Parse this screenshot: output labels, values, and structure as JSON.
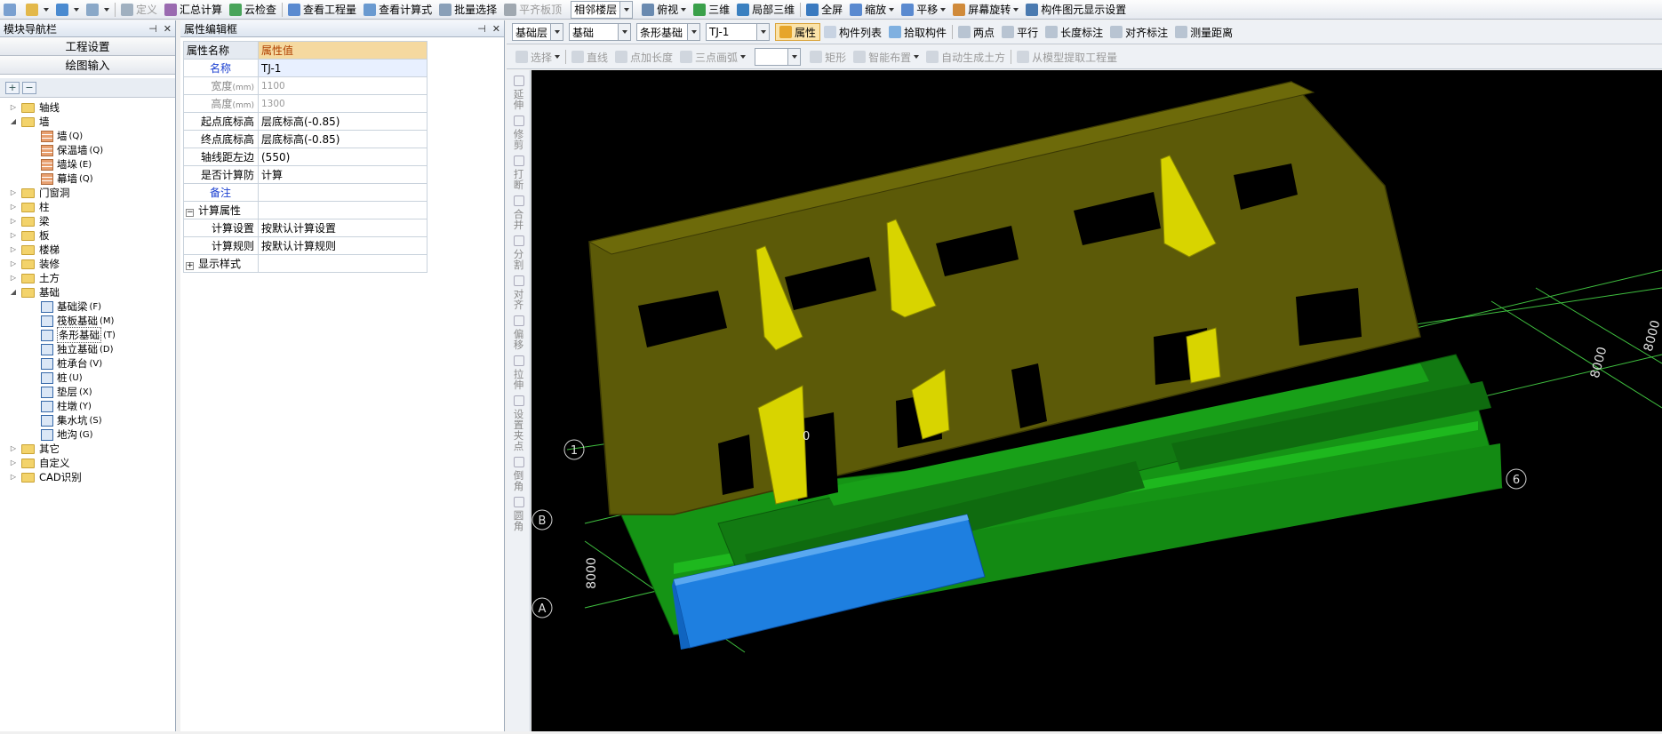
{
  "main_toolbar": [
    {
      "label": "",
      "icon": "new-file-icon"
    },
    {
      "label": "",
      "icon": "open-folder-icon"
    },
    {
      "label": "",
      "icon": "undo-icon"
    },
    {
      "label": "",
      "icon": "redo-icon"
    },
    {
      "label": "定义",
      "icon": "define-icon",
      "disabled": true
    },
    {
      "label": "汇总计算",
      "icon": "sigma-icon"
    },
    {
      "label": "云检查",
      "icon": "cloud-check-icon"
    },
    {
      "label": "查看工程量",
      "icon": "view-quantity-icon"
    },
    {
      "label": "查看计算式",
      "icon": "view-formula-icon"
    },
    {
      "label": "批量选择",
      "icon": "batch-select-icon"
    },
    {
      "label": "平齐板顶",
      "icon": "align-slab-icon",
      "disabled": true
    },
    {
      "label": "相邻楼层",
      "icon": "",
      "combo": true
    },
    {
      "label": "俯视",
      "icon": "top-view-icon",
      "dropdown": true
    },
    {
      "label": "三维",
      "icon": "3d-icon"
    },
    {
      "label": "局部三维",
      "icon": "local-3d-icon"
    },
    {
      "label": "全屏",
      "icon": "fullscreen-icon"
    },
    {
      "label": "缩放",
      "icon": "zoom-icon",
      "dropdown": true
    },
    {
      "label": "平移",
      "icon": "pan-icon",
      "dropdown": true
    },
    {
      "label": "屏幕旋转",
      "icon": "rotate-screen-icon",
      "dropdown": true
    },
    {
      "label": "构件图元显示设置",
      "icon": "display-settings-icon"
    }
  ],
  "nav": {
    "title": "模块导航栏",
    "btn_project": "工程设置",
    "btn_draw": "绘图输入",
    "tree": [
      {
        "label": "轴线",
        "level": 0,
        "expanded": false,
        "type": "folder"
      },
      {
        "label": "墙",
        "level": 0,
        "expanded": true,
        "type": "folder"
      },
      {
        "label": "墙",
        "key": "(Q)",
        "level": 1,
        "type": "wall"
      },
      {
        "label": "保温墙",
        "key": "(Q)",
        "level": 1,
        "type": "wall"
      },
      {
        "label": "墙垛",
        "key": "(E)",
        "level": 1,
        "type": "wall"
      },
      {
        "label": "幕墙",
        "key": "(Q)",
        "level": 1,
        "type": "wall"
      },
      {
        "label": "门窗洞",
        "level": 0,
        "expanded": false,
        "type": "folder"
      },
      {
        "label": "柱",
        "level": 0,
        "expanded": false,
        "type": "folder"
      },
      {
        "label": "梁",
        "level": 0,
        "expanded": false,
        "type": "folder"
      },
      {
        "label": "板",
        "level": 0,
        "expanded": false,
        "type": "folder"
      },
      {
        "label": "楼梯",
        "level": 0,
        "expanded": false,
        "type": "folder"
      },
      {
        "label": "装修",
        "level": 0,
        "expanded": false,
        "type": "folder"
      },
      {
        "label": "土方",
        "level": 0,
        "expanded": false,
        "type": "folder"
      },
      {
        "label": "基础",
        "level": 0,
        "expanded": true,
        "type": "folder"
      },
      {
        "label": "基础梁",
        "key": "(F)",
        "level": 1,
        "type": "comp"
      },
      {
        "label": "筏板基础",
        "key": "(M)",
        "level": 1,
        "type": "comp"
      },
      {
        "label": "条形基础",
        "key": "(T)",
        "level": 1,
        "type": "comp",
        "selected": true
      },
      {
        "label": "独立基础",
        "key": "(D)",
        "level": 1,
        "type": "comp"
      },
      {
        "label": "桩承台",
        "key": "(V)",
        "level": 1,
        "type": "comp"
      },
      {
        "label": "桩",
        "key": "(U)",
        "level": 1,
        "type": "comp"
      },
      {
        "label": "垫层",
        "key": "(X)",
        "level": 1,
        "type": "comp"
      },
      {
        "label": "柱墩",
        "key": "(Y)",
        "level": 1,
        "type": "comp"
      },
      {
        "label": "集水坑",
        "key": "(S)",
        "level": 1,
        "type": "comp"
      },
      {
        "label": "地沟",
        "key": "(G)",
        "level": 1,
        "type": "comp"
      },
      {
        "label": "其它",
        "level": 0,
        "expanded": false,
        "type": "folder"
      },
      {
        "label": "自定义",
        "level": 0,
        "expanded": false,
        "type": "folder"
      },
      {
        "label": "CAD识别",
        "level": 0,
        "expanded": false,
        "type": "folder"
      }
    ]
  },
  "prop": {
    "title": "属性编辑框",
    "h_name": "属性名称",
    "h_value": "属性值",
    "rows": [
      {
        "k": "名称",
        "v": "TJ-1",
        "kc": "blue",
        "sel": true
      },
      {
        "k": "宽度",
        "ku": "(mm)",
        "v": "1100",
        "kc": "gray",
        "vc": "gray"
      },
      {
        "k": "高度",
        "ku": "(mm)",
        "v": "1300",
        "kc": "gray",
        "vc": "gray"
      },
      {
        "k": "起点底标高",
        "v": "层底标高(-0.85)"
      },
      {
        "k": "终点底标高",
        "v": "层底标高(-0.85)"
      },
      {
        "k": "轴线距左边",
        "v": "(550)"
      },
      {
        "k": "是否计算防",
        "v": "计算"
      },
      {
        "k": "备注",
        "v": "",
        "kc": "blue"
      }
    ],
    "group1": "计算属性",
    "group1_rows": [
      {
        "k": "计算设置",
        "v": "按默认计算设置"
      },
      {
        "k": "计算规则",
        "v": "按默认计算规则"
      }
    ],
    "group2": "显示样式"
  },
  "bar2": {
    "combo_floor": "基础层",
    "combo_type": "基础",
    "combo_sub": "条形基础",
    "combo_comp": "TJ-1",
    "btn_prop": "属性",
    "btn_list": "构件列表",
    "btn_pick": "拾取构件",
    "btn_two": "两点",
    "btn_parallel": "平行",
    "btn_length": "长度标注",
    "btn_align": "对齐标注",
    "btn_measure": "测量距离"
  },
  "bar3": {
    "btn_select": "选择",
    "btn_line": "直线",
    "btn_pointlen": "点加长度",
    "btn_arc": "三点画弧",
    "btn_rect": "矩形",
    "btn_smart": "智能布置",
    "btn_auto": "自动生成土方",
    "btn_extract": "从模型提取工程量"
  },
  "vtools": [
    {
      "label": "延伸"
    },
    {
      "label": "修剪"
    },
    {
      "label": "打断"
    },
    {
      "label": "合并"
    },
    {
      "label": "分割"
    },
    {
      "label": "对齐"
    },
    {
      "label": "偏移"
    },
    {
      "label": "拉伸"
    },
    {
      "label": "设置夹点"
    },
    {
      "label": "倒角"
    },
    {
      "label": "圆角"
    }
  ],
  "scene": {
    "axis_labels": [
      "1",
      "6",
      "A",
      "B"
    ],
    "dims": [
      "8000",
      "8000",
      "8000"
    ],
    "partial_num": "0",
    "colors": {
      "wall": "#5c5a08",
      "wall_edge": "#3c3a04",
      "brace": "#d8d400",
      "footing": "#159415",
      "footing_selected": "#1e7fe0",
      "grid_line": "#3fbf3f",
      "bg": "#000000"
    }
  }
}
